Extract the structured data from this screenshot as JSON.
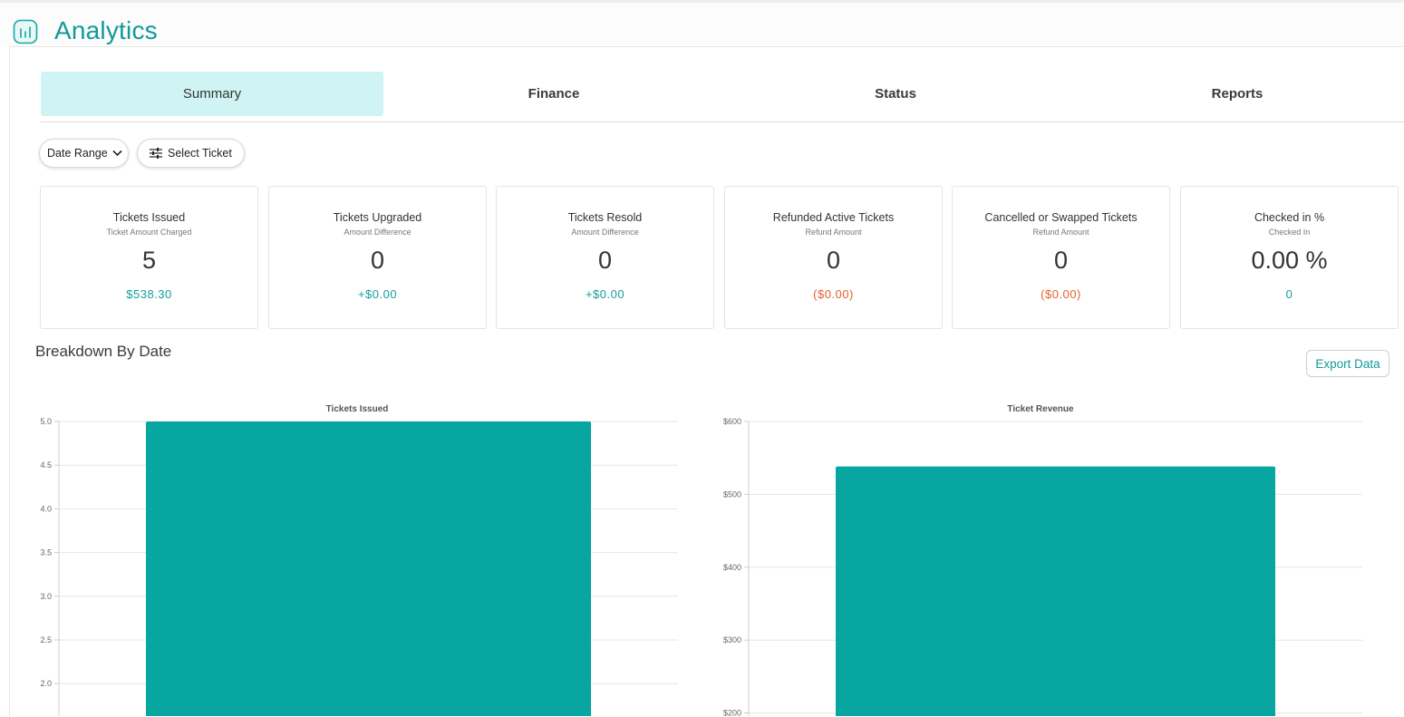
{
  "header": {
    "title": "Analytics",
    "icon": "bar-chart-icon",
    "accent": "#119a99"
  },
  "tabs": [
    {
      "label": "Summary",
      "active": true
    },
    {
      "label": "Finance",
      "active": false
    },
    {
      "label": "Status",
      "active": false
    },
    {
      "label": "Reports",
      "active": false
    }
  ],
  "filters": {
    "date_range_label": "Date Range",
    "select_ticket_label": "Select Ticket"
  },
  "cards": [
    {
      "title": "Tickets Issued",
      "subtitle": "Ticket Amount Charged",
      "value": "5",
      "amount": "$538.30",
      "amount_color": "teal"
    },
    {
      "title": "Tickets Upgraded",
      "subtitle": "Amount Difference",
      "value": "0",
      "amount": "+$0.00",
      "amount_color": "teal"
    },
    {
      "title": "Tickets Resold",
      "subtitle": "Amount Difference",
      "value": "0",
      "amount": "+$0.00",
      "amount_color": "teal"
    },
    {
      "title": "Refunded Active Tickets",
      "subtitle": "Refund Amount",
      "value": "0",
      "amount": "($0.00)",
      "amount_color": "orange"
    },
    {
      "title": "Cancelled or Swapped Tickets",
      "subtitle": "Refund Amount",
      "value": "0",
      "amount": "($0.00)",
      "amount_color": "orange"
    },
    {
      "title": "Checked in %",
      "subtitle": "Checked In",
      "value": "0.00 %",
      "amount": "0",
      "amount_color": "teal"
    }
  ],
  "breakdown": {
    "title": "Breakdown By Date",
    "export_label": "Export Data"
  },
  "chart_data": [
    {
      "type": "bar",
      "title": "Tickets Issued",
      "categories": [
        ""
      ],
      "values": [
        5
      ],
      "ylim": [
        2.0,
        5.0
      ],
      "yticks": [
        "5.0",
        "4.5",
        "4.0",
        "3.5",
        "3.0",
        "2.5",
        "2.0"
      ],
      "grid": true,
      "color": "#08a6a0"
    },
    {
      "type": "bar",
      "title": "Ticket Revenue",
      "categories": [
        ""
      ],
      "values": [
        538.3
      ],
      "ylim": [
        200,
        600
      ],
      "yticks": [
        "$600",
        "$500",
        "$400",
        "$300",
        "$200"
      ],
      "grid": true,
      "color": "#08a6a0"
    }
  ]
}
